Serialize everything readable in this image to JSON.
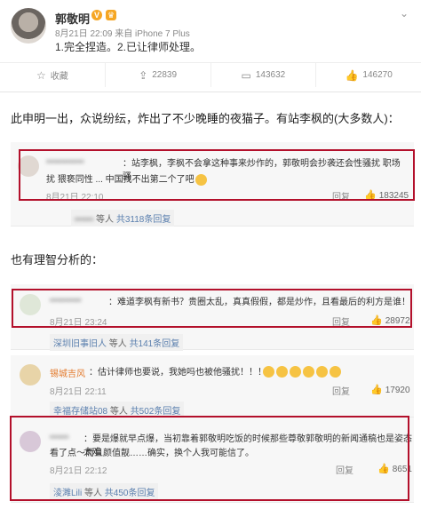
{
  "post": {
    "author": "郭敬明",
    "verified_badge": "V",
    "vip_badge": "♛",
    "time": "8月21日 22:09",
    "source": "来自 iPhone 7 Plus",
    "text": "1.完全捏造。2.已让律师处理。",
    "actions": [
      {
        "icon": "star-icon",
        "label": "收藏"
      },
      {
        "icon": "repost-icon",
        "label": "22839"
      },
      {
        "icon": "comment-icon",
        "label": "143632"
      },
      {
        "icon": "like-icon",
        "label": "146270"
      }
    ]
  },
  "para1": "此申明一出，众说纷纭，炸出了不少晚睡的夜猫子。有站李枫的(大多数人)：",
  "para2": "也有理智分析的：",
  "comments": [
    {
      "name": "▪▪▪▪▪▪▪▪▪▪▪▪",
      "text_line1": "：站李枫，李枫不会拿这种事来炒作的，郭敬明会抄袭还会性骚扰 职场骚",
      "text_line2": "扰 猥亵同性 ... 中国找不出第二个了吧",
      "time": "8月21日 22:10",
      "reply": "回复",
      "likes": "183245",
      "sub_prefix": "▪▪▪▪▪▪",
      "sub_text": " 等人 ",
      "sub_count": "共3118条回复"
    },
    {
      "name": "▪▪▪▪▪▪▪▪▪▪",
      "text_line1": "：难道李枫有新书？贵圈太乱，真真假假，都是炒作，且看最后的利方是谁！",
      "time": "8月21日 23:24",
      "reply": "回复",
      "likes": "28972",
      "sub_prefix": "深圳旧事旧人",
      "sub_text": " 等人 ",
      "sub_count": "共141条回复"
    },
    {
      "name": "锡城吉风",
      "text_line1": "：估计律师也要说，我她吗也被他骚扰！！！",
      "time": "8月21日 22:11",
      "reply": "回复",
      "likes": "17920",
      "sub_prefix": "幸福存储站08",
      "sub_text": " 等人 ",
      "sub_count": "共502条回复"
    },
    {
      "name": "▪▪▪▪▪▪",
      "text_line1": "：要是爆就早点爆，当初靠着郭敬明吃饭的时候那些尊敬郭敬明的新闻通稿也是姿态太难",
      "text_line2": "看了点～而且颜值靓……确实，换个人我可能信了。",
      "time": "8月21日 22:12",
      "reply": "回复",
      "likes": "8651",
      "sub_prefix": "淩濉Lili",
      "sub_text": " 等人 ",
      "sub_count": "共450条回复"
    }
  ],
  "colors": {
    "frame": "#b3102b",
    "name": "#e37a2c",
    "link": "#5a7fae"
  }
}
